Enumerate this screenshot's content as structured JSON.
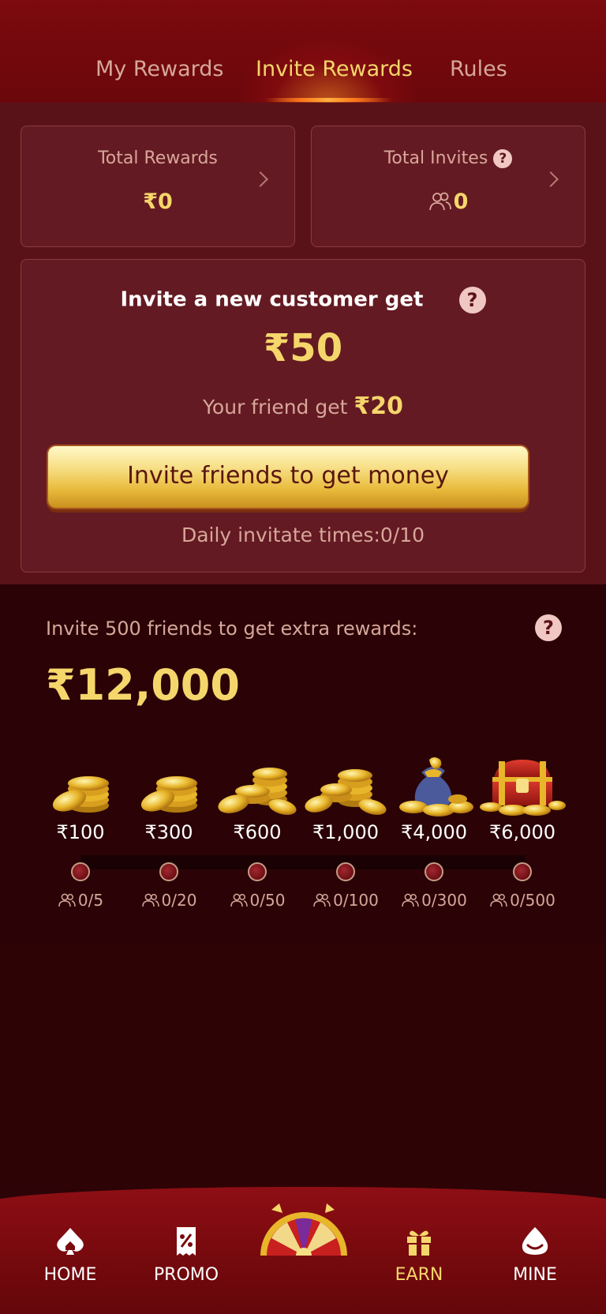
{
  "tabs": [
    {
      "label": "My Rewards",
      "active": false
    },
    {
      "label": "Invite Rewards",
      "active": true
    },
    {
      "label": "Rules",
      "active": false
    }
  ],
  "stats": {
    "total_rewards": {
      "label": "Total Rewards",
      "value": "₹0"
    },
    "total_invites": {
      "label": "Total Invites",
      "value": "0"
    }
  },
  "invite": {
    "title": "Invite a new customer get",
    "amount": "₹50",
    "friend_prefix": "Your friend get",
    "friend_amount": "₹20",
    "button": "Invite friends to get money",
    "daily": "Daily invitate times:0/10"
  },
  "extra": {
    "title": "Invite 500 friends to get extra rewards:",
    "amount": "₹12,000",
    "tiers": [
      {
        "reward": "₹100",
        "progress": "0/5",
        "icon": "small-coin-stack-icon"
      },
      {
        "reward": "₹300",
        "progress": "0/20",
        "icon": "small-coin-stack-icon"
      },
      {
        "reward": "₹600",
        "progress": "0/50",
        "icon": "coin-pile-icon"
      },
      {
        "reward": "₹1,000",
        "progress": "0/100",
        "icon": "coin-pile-icon"
      },
      {
        "reward": "₹4,000",
        "progress": "0/300",
        "icon": "money-bag-icon"
      },
      {
        "reward": "₹6,000",
        "progress": "0/500",
        "icon": "treasure-chest-icon"
      }
    ]
  },
  "nav": [
    {
      "label": "HOME",
      "icon": "spade-home-icon",
      "active": false
    },
    {
      "label": "PROMO",
      "icon": "promo-ticket-icon",
      "active": false
    },
    {
      "label": "EARN",
      "icon": "gift-icon",
      "active": true
    },
    {
      "label": "MINE",
      "icon": "user-drop-icon",
      "active": false
    }
  ],
  "colors": {
    "accent_gold": "#f5d66b",
    "header_red": "#7c0a0e",
    "card_red": "#641a22",
    "background": "#2c0306"
  }
}
